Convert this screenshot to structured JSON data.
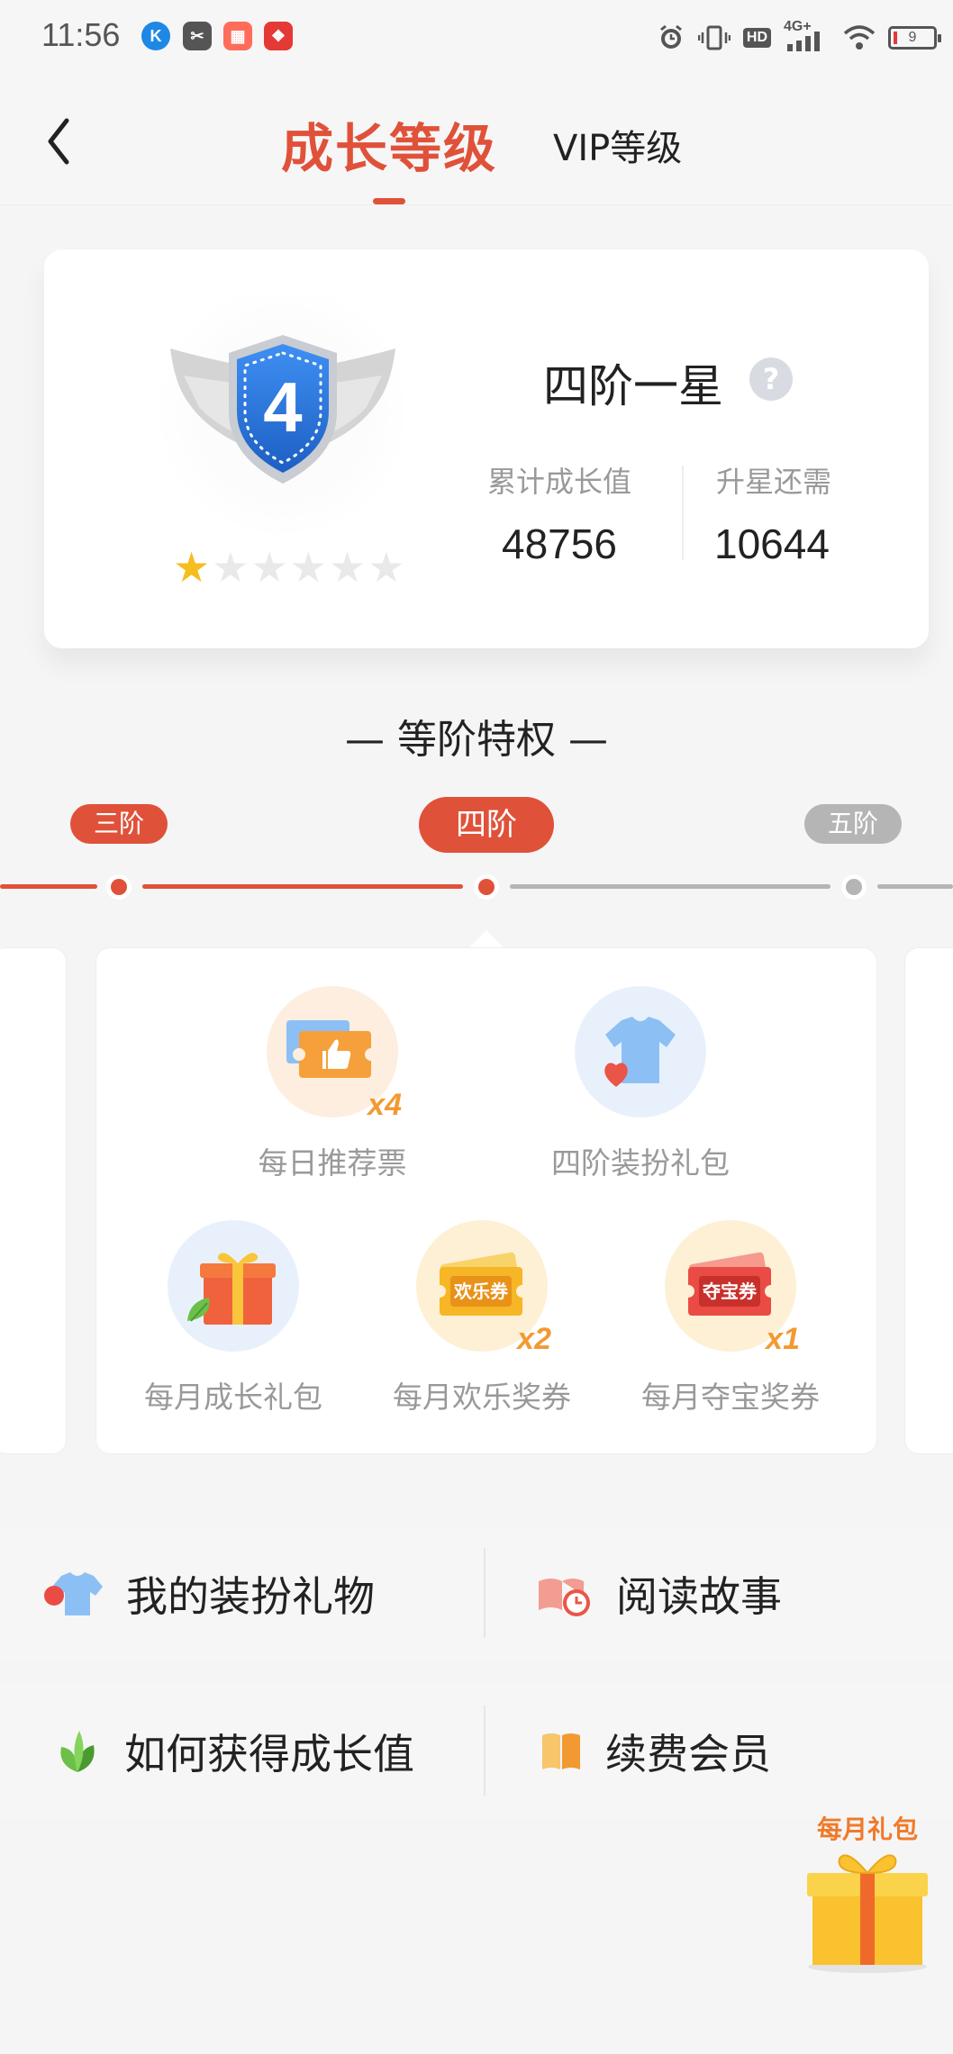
{
  "status_bar": {
    "time": "11:56",
    "network": "4G+",
    "hd": "HD",
    "battery": "9",
    "app_icons": [
      "k-app-icon",
      "scissors-app-icon",
      "gallery-app-icon",
      "gift-app-icon"
    ]
  },
  "header": {
    "tab_active": "成长等级",
    "tab_other": "VIP等级",
    "accent": "#e0513a"
  },
  "level_card": {
    "badge_number": "4",
    "stars_filled": 1,
    "stars_total": 6,
    "level_name": "四阶一星",
    "help": "?",
    "total_label": "累计成长值",
    "total_value": "48756",
    "upgrade_label": "升星还需",
    "upgrade_value": "10644"
  },
  "privileges": {
    "title": "— 等阶特权 —",
    "tiers": [
      {
        "label": "三阶",
        "state": "reached"
      },
      {
        "label": "四阶",
        "state": "current"
      },
      {
        "label": "五阶",
        "state": "locked"
      }
    ],
    "items": [
      {
        "label": "每日推荐票",
        "multiplier": "x4",
        "icon": "ticket-thumbs-up-icon"
      },
      {
        "label": "四阶装扮礼包",
        "multiplier": "",
        "icon": "shirt-heart-icon"
      },
      {
        "label": "每月成长礼包",
        "multiplier": "",
        "icon": "gift-leaf-icon"
      },
      {
        "label": "每月欢乐奖券",
        "multiplier": "x2",
        "icon": "ticket-icon",
        "ticket_text": "欢乐券"
      },
      {
        "label": "每月夺宝奖券",
        "multiplier": "x1",
        "icon": "ticket-icon",
        "ticket_text": "夺宝券"
      }
    ]
  },
  "menu": {
    "items": [
      {
        "label": "我的装扮礼物",
        "icon": "shirt-icon"
      },
      {
        "label": "阅读故事",
        "icon": "story-clock-icon"
      },
      {
        "label": "如何获得成长值",
        "icon": "leaf-icon"
      },
      {
        "label": "续费会员",
        "icon": "book-icon"
      }
    ]
  },
  "float_gift": {
    "label": "每月礼包"
  },
  "colors": {
    "accent": "#e0513a",
    "grey": "#b5b5b5",
    "gold": "#f29a32"
  }
}
